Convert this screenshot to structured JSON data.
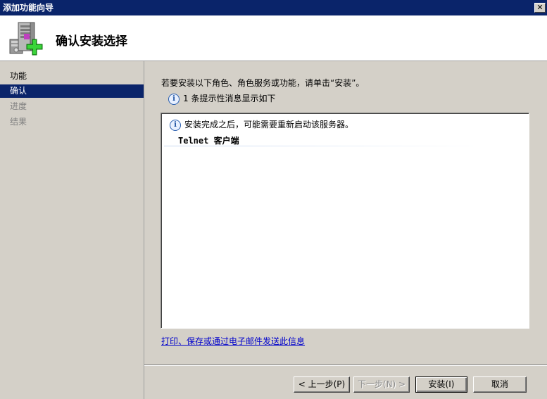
{
  "window": {
    "title": "添加功能向导",
    "close_glyph": "✕"
  },
  "header": {
    "heading": "确认安装选择"
  },
  "sidebar": {
    "items": [
      {
        "label": "功能",
        "state": "normal"
      },
      {
        "label": "确认",
        "state": "active"
      },
      {
        "label": "进度",
        "state": "disabled"
      },
      {
        "label": "结果",
        "state": "disabled"
      }
    ]
  },
  "main": {
    "intro": "若要安装以下角色、角色服务或功能，请单击“安装”。",
    "info_summary": "1 条提示性消息显示如下",
    "info_glyph": "i",
    "list": {
      "message": "安装完成之后，可能需要重新启动该服务器。",
      "feature": "Telnet 客户端"
    },
    "link": "打印、保存或通过电子邮件发送此信息"
  },
  "buttons": {
    "back": "< 上一步(P)",
    "next": "下一步(N) >",
    "install": "安装(I)",
    "cancel": "取消"
  },
  "colors": {
    "titlebar": "#0a246a",
    "selection": "#0a246a",
    "link": "#0000cc",
    "face": "#d4d0c8"
  }
}
